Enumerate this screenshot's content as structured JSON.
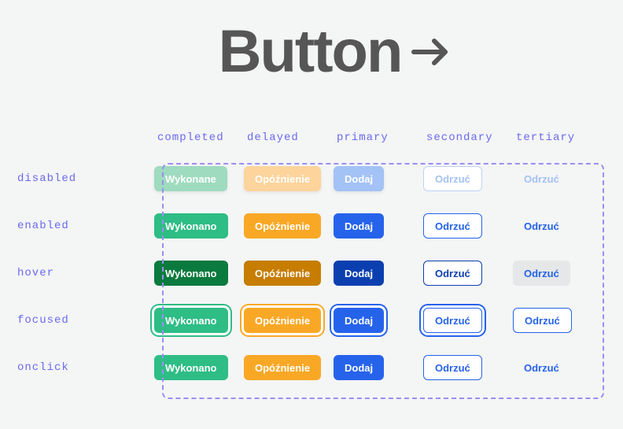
{
  "title": "Button",
  "columns": [
    "completed",
    "delayed",
    "primary",
    "secondary",
    "tertiary"
  ],
  "rows": [
    "disabled",
    "enabled",
    "hover",
    "focused",
    "onclick"
  ],
  "labels": {
    "completed": {
      "disabled": "Wykonane",
      "enabled": "Wykonano",
      "hover": "Wykonano",
      "focused": "Wykonano",
      "onclick": "Wykonano"
    },
    "delayed": {
      "disabled": "Opóźnienie",
      "enabled": "Opóźnienie",
      "hover": "Opóźnienie",
      "focused": "Opóźnienie",
      "onclick": "Opóźnienie"
    },
    "primary": {
      "disabled": "Dodaj",
      "enabled": "Dodaj",
      "hover": "Dodaj",
      "focused": "Dodaj",
      "onclick": "Dodaj"
    },
    "secondary": {
      "disabled": "Odrzuć",
      "enabled": "Odrzuć",
      "hover": "Odrzuć",
      "focused": "Odrzuć",
      "onclick": "Odrzuć"
    },
    "tertiary": {
      "disabled": "Odrzuć",
      "enabled": "Odrzuć",
      "hover": "Odrzuć",
      "focused": "Odrzuć",
      "onclick": "Odrzuć"
    }
  }
}
